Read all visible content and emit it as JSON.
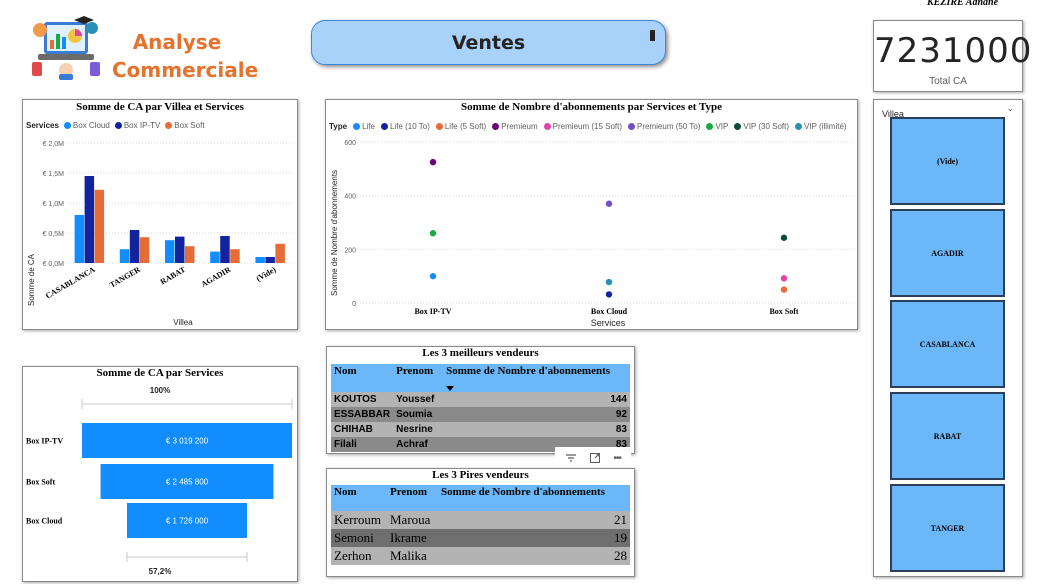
{
  "author": "KEZIRE Adnane",
  "app_title": {
    "line1": "Analyse",
    "line2": "Commerciale"
  },
  "page_button": {
    "label": "Ventes"
  },
  "kpi": {
    "value": "7231000",
    "label": "Total CA"
  },
  "colors": {
    "box_cloud": "#118dff",
    "box_iptv": "#12239e",
    "box_soft": "#e66c37",
    "accent_blue": "#6bb7f7",
    "funnel": "#118dff"
  },
  "bar_chart": {
    "title": "Somme de CA par Villea et Services",
    "legend_title": "Services",
    "series_names": [
      "Box Cloud",
      "Box IP-TV",
      "Box Soft"
    ],
    "y_ticks": [
      "€ 2,0M",
      "€ 1,5M",
      "€ 1,0M",
      "€ 0,5M",
      "€ 0,0M"
    ],
    "ylabel": "Somme de CA",
    "xlabel": "Villea",
    "categories": [
      "CASABLANCA",
      "TANGER",
      "RABAT",
      "AGADIR",
      "(Vide)"
    ]
  },
  "scatter_chart": {
    "title": "Somme de Nombre d'abonnements par Services et Type",
    "legend_title": "Type",
    "types": [
      {
        "name": "Life",
        "color": "#118dff"
      },
      {
        "name": "Life (10 To)",
        "color": "#12239e"
      },
      {
        "name": "Life (5 Soft)",
        "color": "#e66c37"
      },
      {
        "name": "Premieum",
        "color": "#6b007b"
      },
      {
        "name": "Premieum (15 Soft)",
        "color": "#e044a7"
      },
      {
        "name": "Premieum (50 To)",
        "color": "#744ec2"
      },
      {
        "name": "VIP",
        "color": "#1aab40"
      },
      {
        "name": "VIP (30 Soft)",
        "color": "#0b4b3c"
      },
      {
        "name": "VIP (illimité)",
        "color": "#2c8fb8"
      }
    ],
    "y_ticks": [
      "600",
      "400",
      "200",
      "0"
    ],
    "ylabel": "Somme de Nombre d'abonnements",
    "xlabel": "Services",
    "categories": [
      "Box IP-TV",
      "Box Cloud",
      "Box Soft"
    ]
  },
  "funnel": {
    "title": "Somme de CA par Services",
    "top_pct": "100%",
    "bottom_pct": "57,2%",
    "stages": [
      {
        "name": "Box IP-TV",
        "label": "€ 3 019 200"
      },
      {
        "name": "Box Soft",
        "label": "€ 2 485 800"
      },
      {
        "name": "Box Cloud",
        "label": "€ 1 726 000"
      }
    ]
  },
  "best_table": {
    "title": "Les 3 meilleurs vendeurs",
    "columns": [
      "Nom",
      "Prenom",
      "Somme de Nombre d'abonnements"
    ],
    "rows": [
      [
        "KOUTOS",
        "Youssef",
        "144"
      ],
      [
        "ESSABBAR",
        "Soumia",
        "92"
      ],
      [
        "CHIHAB",
        "Nesrine",
        "83"
      ],
      [
        "Filali",
        "Achraf",
        "83"
      ]
    ]
  },
  "worst_table": {
    "title": "Les 3 Pires vendeurs",
    "columns": [
      "Nom",
      "Prenom",
      "Somme de Nombre d'abonnements"
    ],
    "rows": [
      [
        "Kerroum",
        "Maroua",
        "21"
      ],
      [
        "Semoni",
        "Ikrame",
        "19"
      ],
      [
        "Zerhon",
        "Malika",
        "28"
      ]
    ]
  },
  "slicer": {
    "header": "Villea",
    "items": [
      "(Vide)",
      "AGADIR",
      "CASABLANCA",
      "RABAT",
      "TANGER"
    ]
  },
  "chart_data": [
    {
      "type": "bar",
      "title": "Somme de CA par Villea et Services",
      "xlabel": "Villea",
      "ylabel": "Somme de CA",
      "ylim": [
        0,
        2000000
      ],
      "categories": [
        "CASABLANCA",
        "TANGER",
        "RABAT",
        "AGADIR",
        "(Vide)"
      ],
      "series": [
        {
          "name": "Box Cloud",
          "values": [
            800000,
            230000,
            380000,
            190000,
            100000
          ]
        },
        {
          "name": "Box IP-TV",
          "values": [
            1450000,
            550000,
            440000,
            450000,
            100000
          ]
        },
        {
          "name": "Box Soft",
          "values": [
            1220000,
            430000,
            280000,
            230000,
            320000
          ]
        }
      ]
    },
    {
      "type": "scatter",
      "title": "Somme de Nombre d'abonnements par Services et Type",
      "xlabel": "Services",
      "ylabel": "Somme de Nombre d'abonnements",
      "ylim": [
        0,
        600
      ],
      "categories": [
        "Box IP-TV",
        "Box Cloud",
        "Box Soft"
      ],
      "points": [
        {
          "x": "Box IP-TV",
          "type": "Premieum",
          "y": 525
        },
        {
          "x": "Box IP-TV",
          "type": "VIP",
          "y": 260
        },
        {
          "x": "Box IP-TV",
          "type": "Life",
          "y": 100
        },
        {
          "x": "Box Cloud",
          "type": "Premieum (50 To)",
          "y": 370
        },
        {
          "x": "Box Cloud",
          "type": "VIP (illimité)",
          "y": 78
        },
        {
          "x": "Box Cloud",
          "type": "Life (10 To)",
          "y": 32
        },
        {
          "x": "Box Soft",
          "type": "VIP (30 Soft)",
          "y": 243
        },
        {
          "x": "Box Soft",
          "type": "Premieum (15 Soft)",
          "y": 92
        },
        {
          "x": "Box Soft",
          "type": "Life (5 Soft)",
          "y": 50
        }
      ]
    },
    {
      "type": "bar",
      "title": "Somme de CA par Services",
      "categories": [
        "Box IP-TV",
        "Box Soft",
        "Box Cloud"
      ],
      "values": [
        3019200,
        2485800,
        1726000
      ]
    }
  ]
}
